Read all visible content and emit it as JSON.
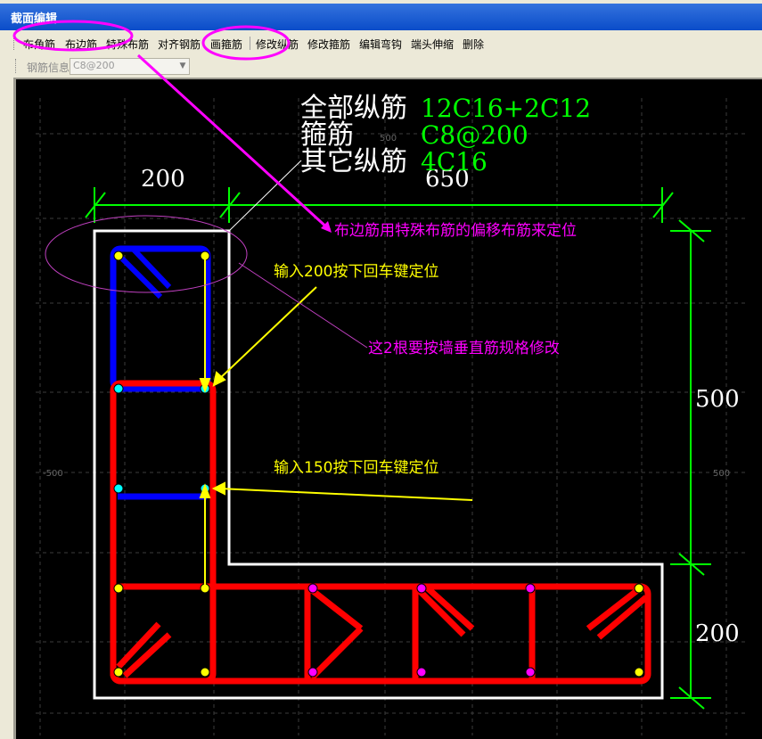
{
  "window": {
    "title": "截面编辑"
  },
  "toolbar": {
    "buttons": [
      "布角筋",
      "布边筋",
      "特殊布筋",
      "对齐钢筋",
      "画箍筋",
      "修改纵筋",
      "修改箍筋",
      "编辑弯钩",
      "端头伸缩",
      "删除"
    ]
  },
  "toolbar2": {
    "label": "钢筋信息",
    "combo_value": "C8@200"
  },
  "drawing": {
    "info": {
      "longitudinal_label": "全部纵筋",
      "longitudinal_value": "12C16+2C12",
      "stirrup_label": "箍筋",
      "stirrup_value": "C8@200",
      "other_label": "其它纵筋",
      "other_value": "4C16"
    },
    "dimensions": {
      "top_left": "200",
      "top_right": "650",
      "right_top": "500",
      "right_bottom": "200"
    },
    "grid_labels": {
      "left": "-500",
      "right": "500",
      "top": "500"
    },
    "annotations": {
      "edge_bar_note": "布边筋用特殊布筋的偏移布筋来定位",
      "input_200": "输入200按下回车键定位",
      "wall_note": "这2根要按墙垂直筋规格修改",
      "input_150": "输入150按下回车键定位"
    }
  },
  "colors": {
    "red_bar": "#ff0000",
    "blue_bar": "#0000ff",
    "green_dim": "#00ff00",
    "yellow_note": "#ffff00",
    "magenta_note": "#ff00ff",
    "white_outline": "#ffffff"
  }
}
